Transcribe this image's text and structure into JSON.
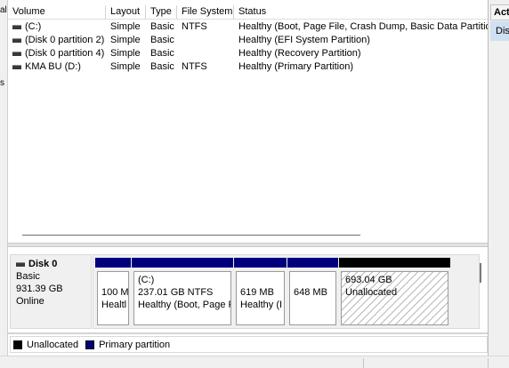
{
  "left_strip": {
    "glyph_top": "al",
    "glyph_mid": "s"
  },
  "volume_list": {
    "columns": [
      "Volume",
      "Layout",
      "Type",
      "File System",
      "Status"
    ],
    "rows": [
      {
        "volume": "(C:)",
        "layout": "Simple",
        "type": "Basic",
        "fs": "NTFS",
        "status": "Healthy (Boot, Page File, Crash Dump, Basic Data Partition)"
      },
      {
        "volume": "(Disk 0 partition 2)",
        "layout": "Simple",
        "type": "Basic",
        "fs": "",
        "status": "Healthy (EFI System Partition)"
      },
      {
        "volume": "(Disk 0 partition 4)",
        "layout": "Simple",
        "type": "Basic",
        "fs": "",
        "status": "Healthy (Recovery Partition)"
      },
      {
        "volume": "KMA BU (D:)",
        "layout": "Simple",
        "type": "Basic",
        "fs": "NTFS",
        "status": "Healthy (Primary Partition)"
      }
    ]
  },
  "disk": {
    "name": "Disk 0",
    "type": "Basic",
    "size": "931.39 GB",
    "state": "Online",
    "partitions": [
      {
        "title": "",
        "size": "100 M",
        "status": "Healtl",
        "kind": "primary"
      },
      {
        "title": "(C:)",
        "size": "237.01 GB NTFS",
        "status": "Healthy (Boot, Page F",
        "kind": "primary"
      },
      {
        "title": "",
        "size": "619 MB",
        "status": "Healthy (I",
        "kind": "primary"
      },
      {
        "title": "",
        "size": "648 MB",
        "status": "",
        "kind": "primary"
      },
      {
        "title": "",
        "size": "693.04 GB",
        "status": "Unallocated",
        "kind": "unallocated"
      }
    ]
  },
  "legend": [
    {
      "label": "Unallocated",
      "color": "#000000"
    },
    {
      "label": "Primary partition",
      "color": "#00007f"
    }
  ],
  "actions": {
    "header": "Acti",
    "item": "Disk"
  },
  "colors": {
    "primary": "#00007f",
    "unallocated": "#000000",
    "selection": "#cfe0f2"
  }
}
